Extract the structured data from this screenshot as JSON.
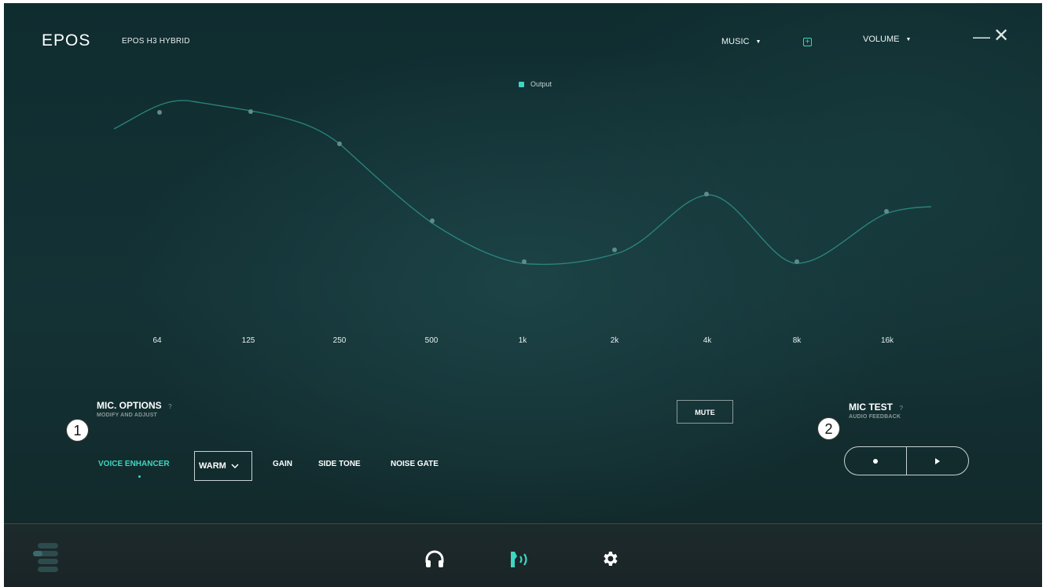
{
  "header": {
    "logo": "EPOS",
    "device_name": "EPOS H3 HYBRID",
    "preset_dropdown": "MUSIC",
    "volume_dropdown": "VOLUME"
  },
  "equalizer": {
    "legend": "Output",
    "accent_color": "#3fd5c2",
    "bands": [
      "64",
      "125",
      "250",
      "500",
      "1k",
      "2k",
      "4k",
      "8k",
      "16k"
    ]
  },
  "mic_options": {
    "title": "MIC. OPTIONS",
    "help": "?",
    "subtitle": "MODIFY AND ADJUST",
    "callout": "1",
    "tabs": [
      "VOICE ENHANCER",
      "GAIN",
      "SIDE TONE",
      "NOISE GATE"
    ],
    "active_tab": "VOICE ENHANCER",
    "voice_enhancer_value": "WARM"
  },
  "mute": {
    "label": "MUTE"
  },
  "mic_test": {
    "title": "MIC TEST",
    "help": "?",
    "subtitle": "AUDIO FEEDBACK",
    "callout": "2"
  },
  "bottom_nav": {
    "items": [
      "menu-icon",
      "headphones-icon",
      "microphone-icon",
      "gear-icon"
    ],
    "active": "microphone-icon"
  }
}
